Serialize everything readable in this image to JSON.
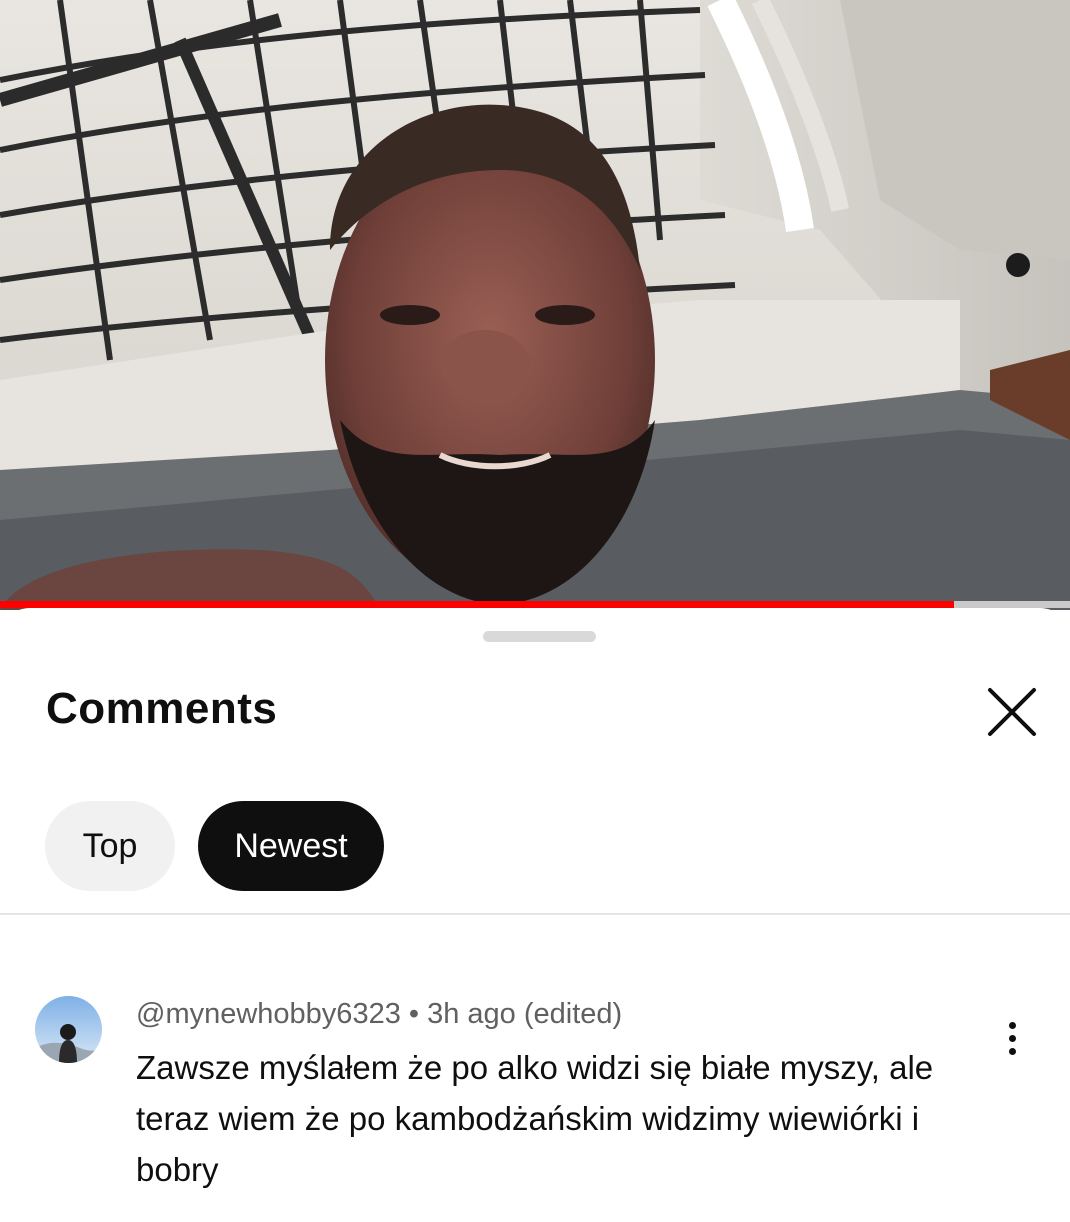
{
  "video": {
    "progress_percent": 89.2,
    "progress_color": "#ff0000"
  },
  "comments_panel": {
    "title": "Comments",
    "close_icon": "close-icon",
    "sort_chips": [
      {
        "label": "Top",
        "selected": false
      },
      {
        "label": "Newest",
        "selected": true
      }
    ]
  },
  "comments": [
    {
      "author": "@mynewhobby6323",
      "separator": "•",
      "time": "3h ago (edited)",
      "text": "Zawsze myślałem że po alko widzi się białe myszy, ale teraz wiem że po kambodżańskim widzimy wiewiórki i bobry",
      "menu_icon": "more-vert-icon"
    }
  ]
}
